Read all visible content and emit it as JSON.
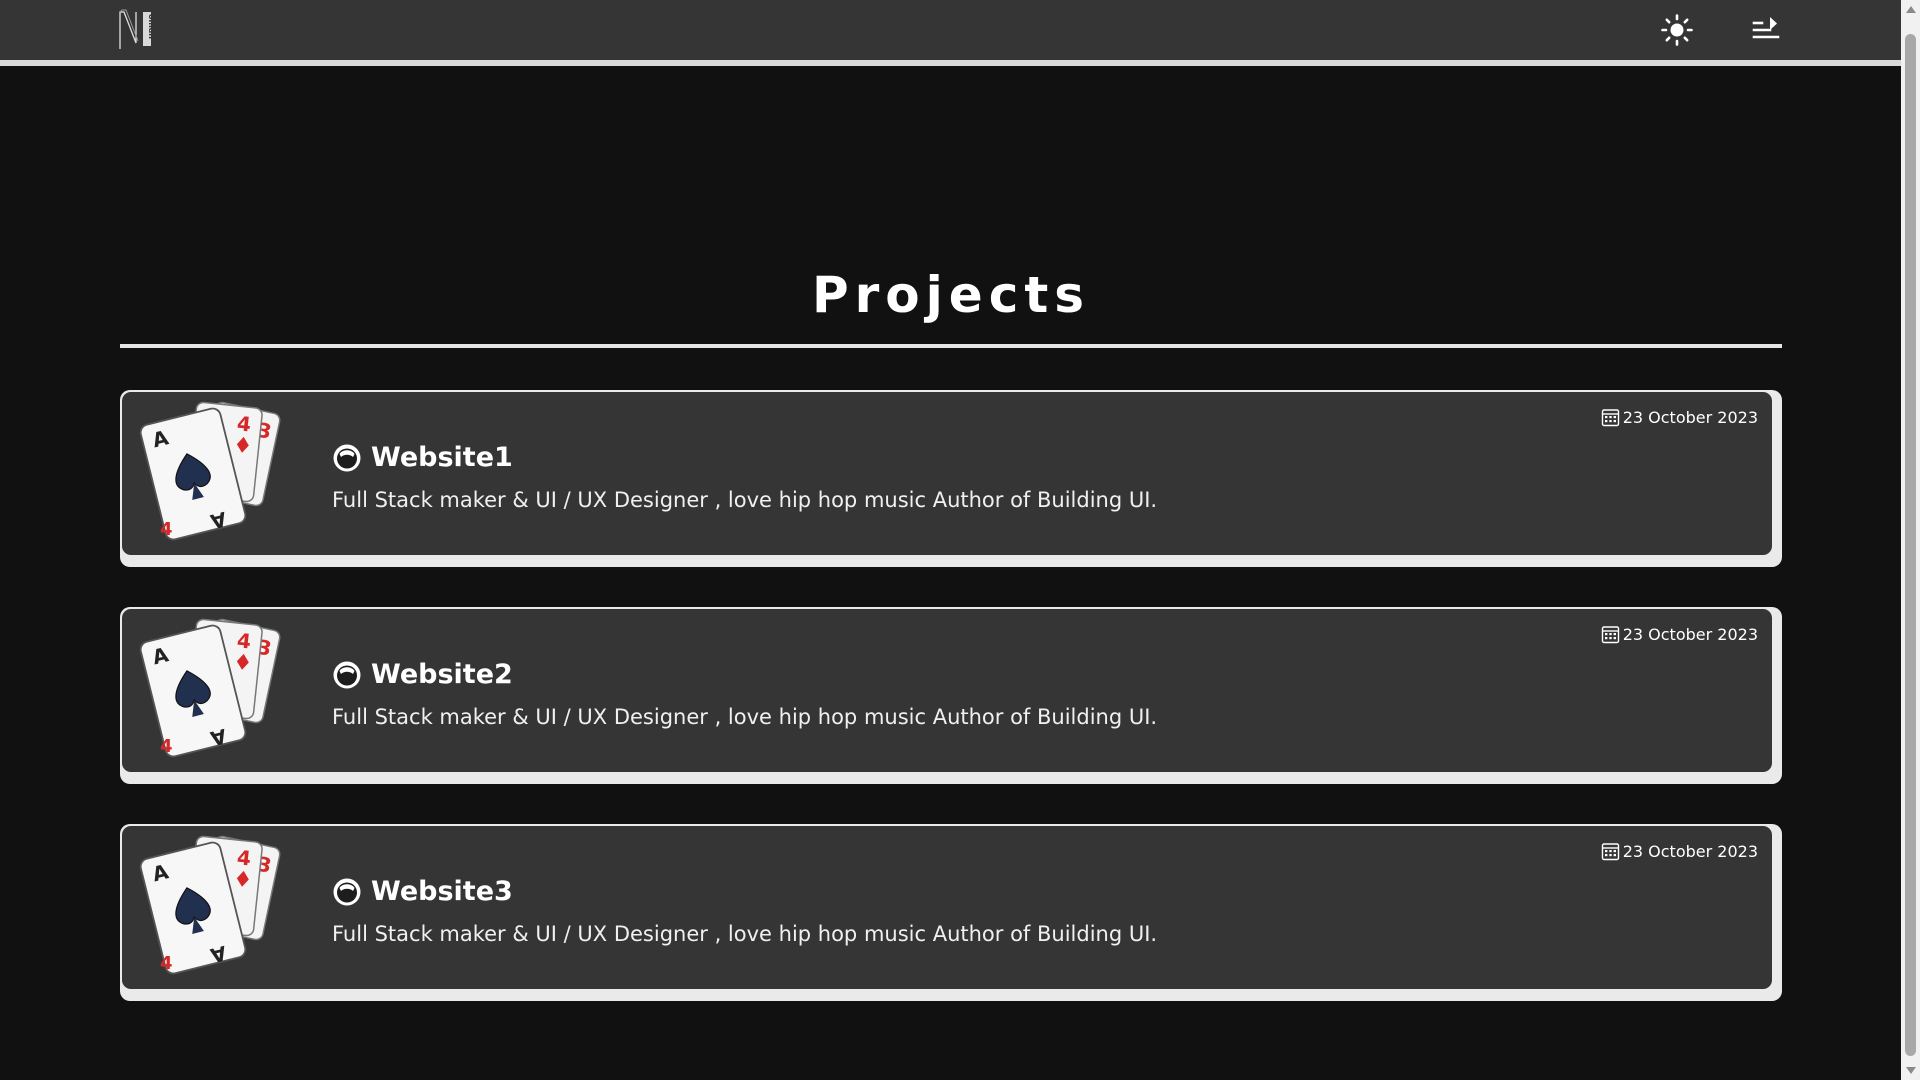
{
  "header": {
    "logo_alt": "N logo",
    "theme_toggle": "sun-icon",
    "menu_toggle": "menu-arrow-icon"
  },
  "page": {
    "title": "Projects"
  },
  "projects": [
    {
      "title": "Website1",
      "date": "23 October 2023",
      "description": "Full Stack maker & UI / UX Designer , love hip hop music Author of Building UI."
    },
    {
      "title": "Website2",
      "date": "23 October 2023",
      "description": "Full Stack maker & UI / UX Designer , love hip hop music Author of Building UI."
    },
    {
      "title": "Website3",
      "date": "23 October 2023",
      "description": "Full Stack maker & UI / UX Designer , love hip hop music Author of Building UI."
    }
  ],
  "colors": {
    "background": "#111111",
    "header": "#353535",
    "card": "#353535",
    "card_border": "#eaeaea",
    "text": "#ffffff"
  }
}
